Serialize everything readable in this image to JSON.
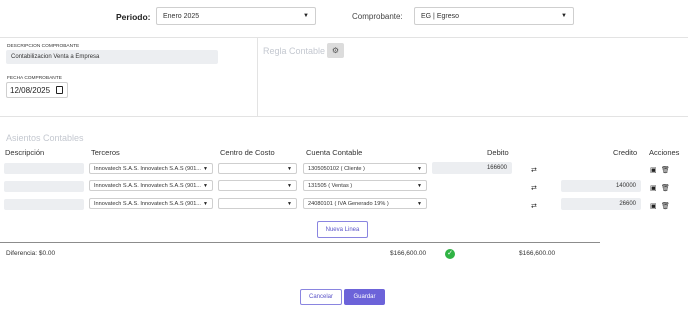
{
  "header": {
    "periodo_label": "Periodo:",
    "periodo_value": "Enero 2025",
    "comprobante_label": "Comprobante:",
    "comprobante_value": "EG | Egreso"
  },
  "form": {
    "descripcion_label": "DESCRIPCION COMPROBANTE",
    "descripcion_value": "Contabilizacion Venta a Empresa",
    "fecha_label": "FECHA COMPROBANTE",
    "fecha_value": "12/08/2025",
    "regla_contable_label": "Regla Contable"
  },
  "asientos": {
    "title": "Asientos Contables",
    "columns": {
      "descripcion": "Descripción",
      "terceros": "Terceros",
      "centro_costo": "Centro de Costo",
      "cuenta": "Cuenta Contable",
      "debito": "Debito",
      "credito": "Credito",
      "acciones": "Acciones"
    },
    "rows": [
      {
        "descripcion": "",
        "tercero": "Innovatech S.A.S. Innovatech S.A.S (901...",
        "centro": "",
        "cuenta": "1305050102 ( Cliente )",
        "debito": "166600",
        "credito": ""
      },
      {
        "descripcion": "",
        "tercero": "Innovatech S.A.S. Innovatech S.A.S (901...",
        "centro": "",
        "cuenta": "131505 ( Ventas )",
        "debito": "",
        "credito": "140000"
      },
      {
        "descripcion": "",
        "tercero": "Innovatech S.A.S. Innovatech S.A.S (901...",
        "centro": "",
        "cuenta": "24080101 ( IVA Generado 19% )",
        "debito": "",
        "credito": "26600"
      }
    ],
    "nueva_linea_label": "Nueva Linea"
  },
  "totals": {
    "diferencia": "Diferencia: $0.00",
    "total_debito": "$166,600.00",
    "total_credito": "$166,600.00"
  },
  "footer": {
    "cancel_label": "Cancelar",
    "save_label": "Guardar"
  },
  "colors": {
    "primary": "#6c63d9",
    "success": "#2fb344"
  }
}
